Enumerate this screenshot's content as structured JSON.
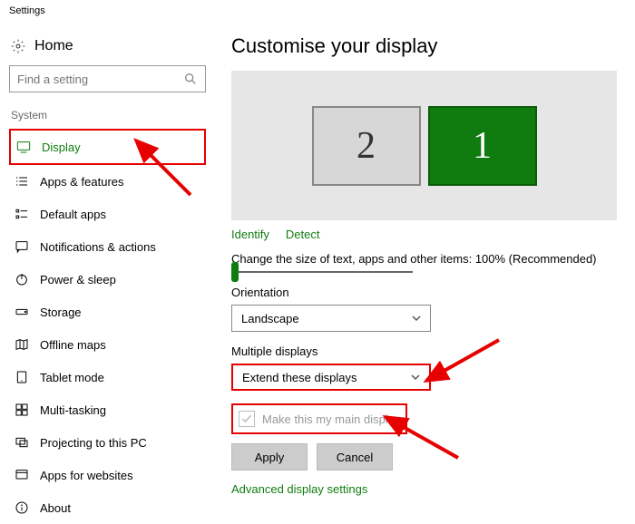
{
  "window_title": "Settings",
  "home_label": "Home",
  "search": {
    "placeholder": "Find a setting"
  },
  "section_heading": "System",
  "nav": [
    {
      "id": "display",
      "label": "Display",
      "active": true,
      "icon": "display-icon"
    },
    {
      "id": "apps",
      "label": "Apps & features",
      "icon": "apps-icon"
    },
    {
      "id": "default",
      "label": "Default apps",
      "icon": "default-apps-icon"
    },
    {
      "id": "notifications",
      "label": "Notifications & actions",
      "icon": "notifications-icon"
    },
    {
      "id": "power",
      "label": "Power & sleep",
      "icon": "power-icon"
    },
    {
      "id": "storage",
      "label": "Storage",
      "icon": "storage-icon"
    },
    {
      "id": "maps",
      "label": "Offline maps",
      "icon": "maps-icon"
    },
    {
      "id": "tablet",
      "label": "Tablet mode",
      "icon": "tablet-icon"
    },
    {
      "id": "multitasking",
      "label": "Multi-tasking",
      "icon": "multitasking-icon"
    },
    {
      "id": "projecting",
      "label": "Projecting to this PC",
      "icon": "projecting-icon"
    },
    {
      "id": "websites",
      "label": "Apps for websites",
      "icon": "websites-icon"
    },
    {
      "id": "about",
      "label": "About",
      "icon": "about-icon"
    }
  ],
  "page_title": "Customise your display",
  "monitors": [
    {
      "num": "2",
      "active": false
    },
    {
      "num": "1",
      "active": true
    }
  ],
  "links": {
    "identify": "Identify",
    "detect": "Detect"
  },
  "scale_label": "Change the size of text, apps and other items: 100% (Recommended)",
  "orientation": {
    "label": "Orientation",
    "value": "Landscape"
  },
  "multiple": {
    "label": "Multiple displays",
    "value": "Extend these displays"
  },
  "main_display_label": "Make this my main display",
  "buttons": {
    "apply": "Apply",
    "cancel": "Cancel"
  },
  "advanced_link": "Advanced display settings"
}
